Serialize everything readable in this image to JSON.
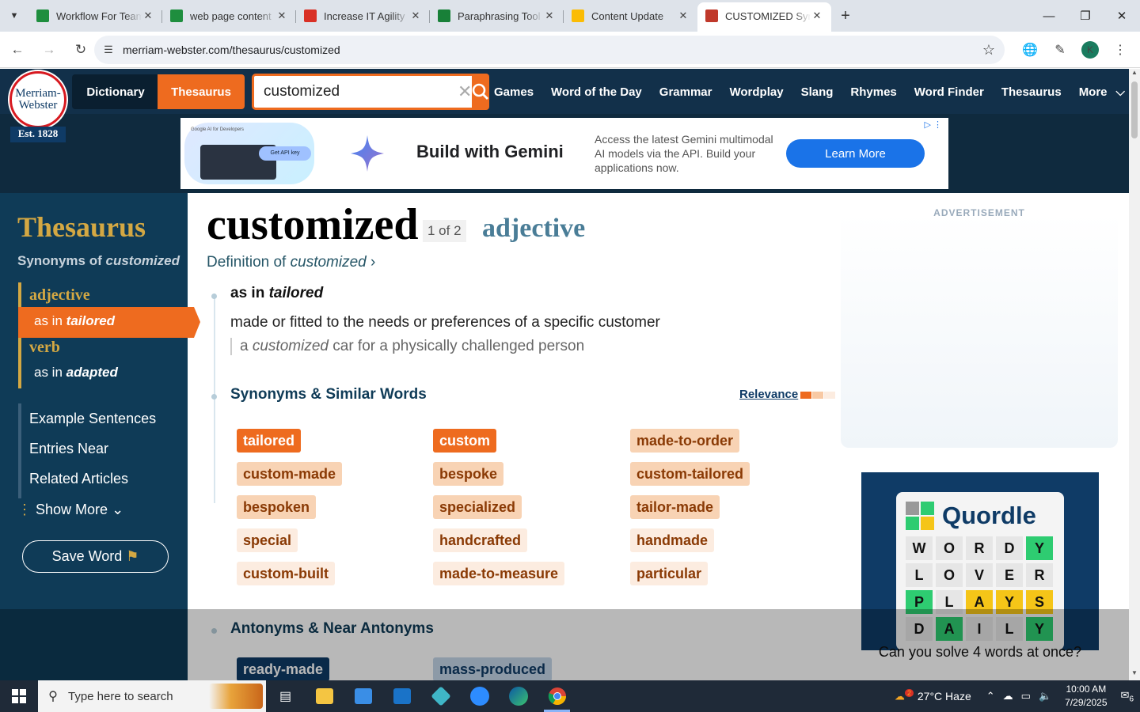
{
  "browser": {
    "tabs": [
      {
        "title": "Workflow For Team",
        "icon_color": "#1e8e3e",
        "icon": "sheets-icon"
      },
      {
        "title": "web page content",
        "icon_color": "#1e8e3e",
        "icon": "sheets-icon"
      },
      {
        "title": "Increase IT Agility",
        "icon_color": "#d93025",
        "icon": "check-icon"
      },
      {
        "title": "Paraphrasing Tool",
        "icon_color": "#188038",
        "icon": "sheets-icon"
      },
      {
        "title": "Content Update",
        "icon_color": "#fbbc04",
        "icon": "drive-icon"
      },
      {
        "title": "CUSTOMIZED Syn",
        "icon_color": "#c0392b",
        "icon": "mw-icon",
        "active": true
      }
    ],
    "url": "merriam-webster.com/thesaurus/customized",
    "profile_initial": "K"
  },
  "site": {
    "logo_line1": "Merriam-",
    "logo_line2": "Webster",
    "est": "Est. 1828",
    "switch_dictionary": "Dictionary",
    "switch_thesaurus": "Thesaurus",
    "search_value": "customized",
    "nav": [
      "Games",
      "Word of the Day",
      "Grammar",
      "Wordplay",
      "Slang",
      "Rhymes",
      "Word Finder",
      "Thesaurus",
      "More"
    ]
  },
  "ad": {
    "small_label": "Google AI for Developers",
    "pill": "Get API key",
    "title": "Build with Gemini",
    "description": "Access the latest Gemini multimodal AI models via the API. Build your applications now.",
    "button": "Learn More"
  },
  "sidebar": {
    "title": "Thesaurus",
    "synonyms_of": "Synonyms of",
    "word": "customized",
    "pos1": "adjective",
    "sense1_prefix": "as in",
    "sense1_word": "tailored",
    "pos2": "verb",
    "sense2_prefix": "as in",
    "sense2_word": "adapted",
    "links": [
      "Example Sentences",
      "Entries Near",
      "Related Articles"
    ],
    "show_more": "Show More",
    "save_word": "Save Word"
  },
  "entry": {
    "headword": "customized",
    "count": "1 of 2",
    "pos": "adjective",
    "definition_link_prefix": "Definition of",
    "definition_link_word": "customized",
    "sense_prefix": "as in",
    "sense_word": "tailored",
    "sense_definition": "made or fitted to the needs or preferences of a specific customer",
    "example_pre": "a",
    "example_word": "customized",
    "example_post": "car for a physically challenged person",
    "synonyms_heading": "Synonyms & Similar Words",
    "relevance_label": "Relevance",
    "synonyms": [
      {
        "word": "tailored",
        "relevance": 3
      },
      {
        "word": "custom",
        "relevance": 3
      },
      {
        "word": "made-to-order",
        "relevance": 2
      },
      {
        "word": "custom-made",
        "relevance": 2
      },
      {
        "word": "bespoke",
        "relevance": 2
      },
      {
        "word": "custom-tailored",
        "relevance": 2
      },
      {
        "word": "bespoken",
        "relevance": 2
      },
      {
        "word": "specialized",
        "relevance": 2
      },
      {
        "word": "tailor-made",
        "relevance": 2
      },
      {
        "word": "special",
        "relevance": 1
      },
      {
        "word": "handcrafted",
        "relevance": 1
      },
      {
        "word": "handmade",
        "relevance": 1
      },
      {
        "word": "custom-built",
        "relevance": 1
      },
      {
        "word": "made-to-measure",
        "relevance": 1
      },
      {
        "word": "particular",
        "relevance": 1
      }
    ],
    "antonyms_heading": "Antonyms & Near Antonyms",
    "antonyms": [
      {
        "word": "ready-made",
        "relevance": 3
      },
      {
        "word": "mass-produced",
        "relevance": 2
      }
    ]
  },
  "right_rail": {
    "ad_label": "ADVERTISEMENT",
    "game_name": "Quordle",
    "grid": [
      [
        "W",
        "O",
        "R",
        "D",
        "Y"
      ],
      [
        "L",
        "O",
        "V",
        "E",
        "R"
      ],
      [
        "P",
        "L",
        "A",
        "Y",
        "S"
      ],
      [
        "D",
        "A",
        "I",
        "L",
        "Y"
      ]
    ],
    "grid_colors": [
      [
        "",
        "",
        "",
        "",
        "g"
      ],
      [
        "",
        "",
        "",
        "",
        ""
      ],
      [
        "g",
        "",
        "y",
        "y",
        "y"
      ],
      [
        "",
        "g",
        "",
        "",
        "g"
      ]
    ],
    "caption": "Can you solve 4 words at once?"
  },
  "taskbar": {
    "search_placeholder": "Type here to search",
    "weather_badge": "2",
    "weather": "27°C  Haze",
    "time": "10:00 AM",
    "date": "7/29/2025",
    "notifications": "6"
  },
  "colors": {
    "brand_blue": "#0f3b57",
    "accent_orange": "#ee6b1f",
    "gold": "#d4a843"
  }
}
